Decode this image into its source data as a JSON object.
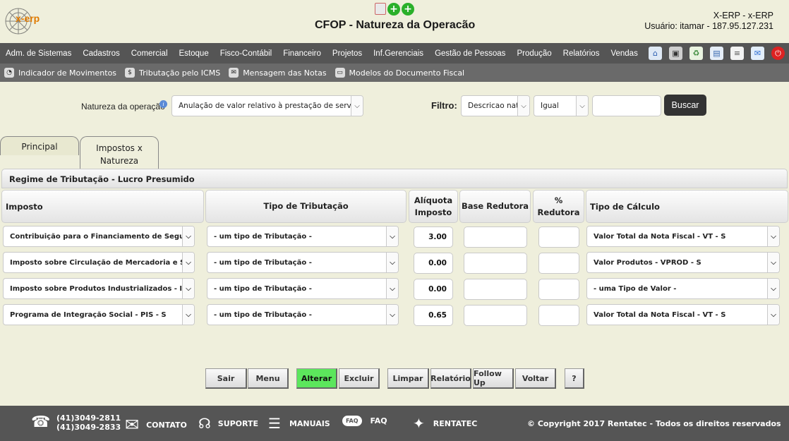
{
  "header": {
    "logo_text": "x-erp",
    "title": "CFOP - Natureza da Operacão",
    "user_line1": "X-ERP - x-ERP",
    "user_line2": "Usuário: itamar - 187.95.127.231"
  },
  "menu": {
    "items": [
      "Adm. de Sistemas",
      "Cadastros",
      "Comercial",
      "Estoque",
      "Fisco-Contábil",
      "Financeiro",
      "Projetos",
      "Inf.Gerenciais",
      "Gestão de Pessoas",
      "Produção",
      "Relatórios",
      "Vendas"
    ],
    "icons": [
      "home-icon",
      "windows-icon",
      "recycle-icon",
      "document-icon",
      "list-icon",
      "chat-icon",
      "power-icon"
    ]
  },
  "submenu": {
    "items": [
      {
        "label": "Indicador de Movimentos",
        "icon": "gauge-icon"
      },
      {
        "label": "Tributação pelo ICMS",
        "icon": "tax-icon"
      },
      {
        "label": "Mensagem das Notas",
        "icon": "mail-icon"
      },
      {
        "label": "Modelos do Documento Fiscal",
        "icon": "file-icon"
      }
    ]
  },
  "filter": {
    "natureza_label": "Natureza da operação",
    "natureza_value": "Anulação de valor relativo à prestação de serviço",
    "filtro_label": "Filtro:",
    "field_value": "Descricao nat",
    "operator_value": "Igual",
    "search_value": "",
    "search_button": "Buscar"
  },
  "tabs": [
    {
      "label": "Principal"
    },
    {
      "label": "Impostos x Natureza"
    }
  ],
  "panel": {
    "title": "Regime de Tributação - Lucro Presumido"
  },
  "table": {
    "headers": {
      "imposto": "Imposto",
      "tipo_tributacao": "Tipo de Tributação",
      "aliquota": "Alíquota Imposto",
      "base_redutora": "Base Redutora",
      "pct_redutora": "% Redutora",
      "tipo_calculo": "Tipo de Cálculo"
    },
    "rows": [
      {
        "imposto": "Contribuição para o Financiamento de Seguridade Social - COFINS - S",
        "tipo": "- um tipo de Tributação -",
        "aliquota": "3.00",
        "base": "",
        "pct": "",
        "calculo": "Valor Total da Nota Fiscal - VT - S"
      },
      {
        "imposto": "Imposto sobre Circulação de Mercadoria e Serviços - ICMS - S",
        "tipo": "- um tipo de Tributação -",
        "aliquota": "0.00",
        "base": "",
        "pct": "",
        "calculo": "Valor Produtos - VPROD - S"
      },
      {
        "imposto": "Imposto sobre Produtos Industrializados - IPI - S",
        "tipo": "- um tipo de Tributação -",
        "aliquota": "0.00",
        "base": "",
        "pct": "",
        "calculo": "- uma Tipo de Valor -"
      },
      {
        "imposto": "Programa de Integração Social - PIS - S",
        "tipo": "- um tipo de Tributação -",
        "aliquota": "0.65",
        "base": "",
        "pct": "",
        "calculo": "Valor Total da Nota Fiscal - VT - S"
      }
    ]
  },
  "actions": {
    "sair": "Sair",
    "menu": "Menu",
    "alterar": "Alterar",
    "excluir": "Excluir",
    "limpar": "Limpar",
    "relatorio": "Relatório",
    "follow_up": "Follow Up",
    "voltar": "Voltar",
    "help": "?"
  },
  "footer": {
    "phone1": "(41)3049-2811",
    "phone2": "(41)3049-2833",
    "contato": "CONTATO",
    "suporte": "SUPORTE",
    "manuais": "MANUAIS",
    "faq": "FAQ",
    "faq_icon_text": "FAQ",
    "rentatec": "RENTATEC",
    "copyright": "© Copyright 2017 Rentatec - Todos os direitos reservados"
  },
  "colors": {
    "page_bg": "#efefdc",
    "menubar": "#555555",
    "submenu": "#6a6a6a",
    "alterar_green": "#5ce65c",
    "buscar_dark": "#333333"
  }
}
